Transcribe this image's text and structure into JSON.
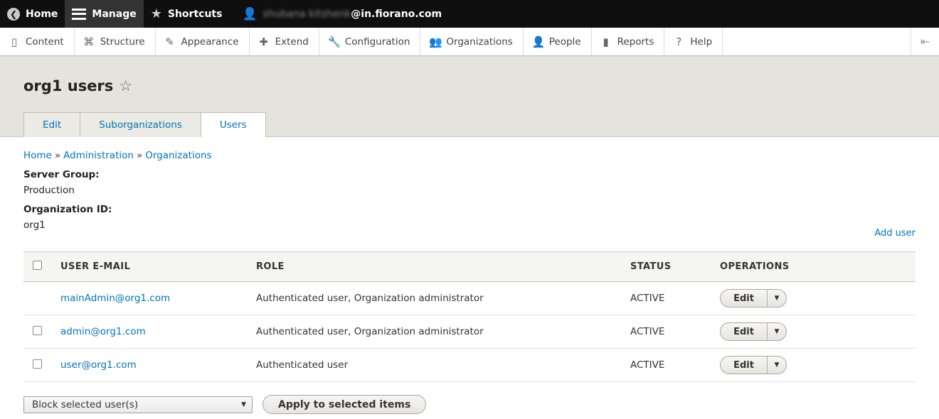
{
  "toolbar": {
    "home": "Home",
    "manage": "Manage",
    "shortcuts": "Shortcuts",
    "user_blurred": "shubana kitshenk",
    "user_domain": "@in.fiorano.com"
  },
  "menu": {
    "items": [
      {
        "label": "Content",
        "icon": "▯"
      },
      {
        "label": "Structure",
        "icon": "⌘"
      },
      {
        "label": "Appearance",
        "icon": "✎"
      },
      {
        "label": "Extend",
        "icon": "✚"
      },
      {
        "label": "Configuration",
        "icon": "🔧"
      },
      {
        "label": "Organizations",
        "icon": "👥"
      },
      {
        "label": "People",
        "icon": "👤"
      },
      {
        "label": "Reports",
        "icon": "▮"
      },
      {
        "label": "Help",
        "icon": "?"
      }
    ]
  },
  "page": {
    "title": "org1 users",
    "tabs": [
      "Edit",
      "Suborganizations",
      "Users"
    ],
    "active_tab": "Users"
  },
  "breadcrumb": {
    "items": [
      "Home",
      "Administration",
      "Organizations"
    ],
    "separator": "»"
  },
  "fields": {
    "server_group_label": "Server Group:",
    "server_group_value": "Production",
    "org_id_label": "Organization ID:",
    "org_id_value": "org1"
  },
  "add_user": "Add user",
  "table": {
    "headers": [
      "USER E-MAIL",
      "ROLE",
      "STATUS",
      "OPERATIONS"
    ],
    "rows": [
      {
        "email": "mainAdmin@org1.com",
        "role": "Authenticated user, Organization administrator",
        "status": "ACTIVE",
        "op": "Edit",
        "checkbox": false
      },
      {
        "email": "admin@org1.com",
        "role": "Authenticated user, Organization administrator",
        "status": "ACTIVE",
        "op": "Edit",
        "checkbox": true
      },
      {
        "email": "user@org1.com",
        "role": "Authenticated user",
        "status": "ACTIVE",
        "op": "Edit",
        "checkbox": true
      }
    ]
  },
  "bulk": {
    "action_selected": "Block selected user(s)",
    "apply_label": "Apply to selected items"
  }
}
